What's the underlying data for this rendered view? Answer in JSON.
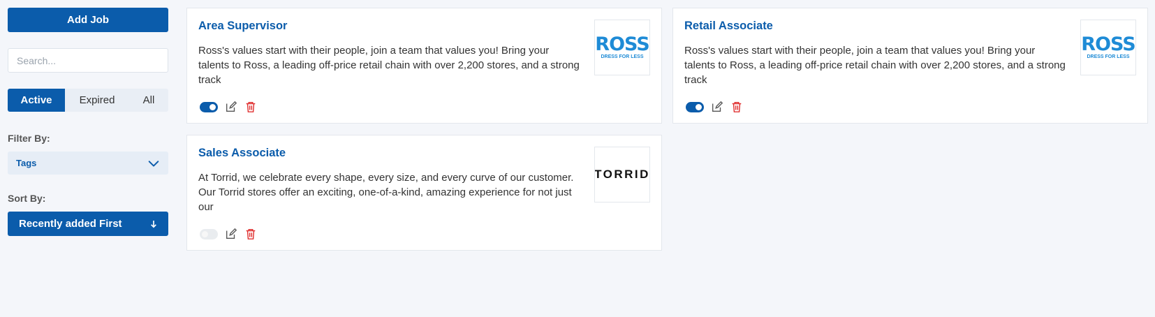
{
  "sidebar": {
    "add_job_label": "Add Job",
    "search_placeholder": "Search...",
    "filters": [
      "Active",
      "Expired",
      "All"
    ],
    "filter_by_label": "Filter By:",
    "tags_label": "Tags",
    "sort_by_label": "Sort By:",
    "sort_value": "Recently added First"
  },
  "jobs": [
    {
      "title": "Area Supervisor",
      "description": "Ross's values start with their people, join a team that values you! Bring your talents to Ross, a leading off-price retail chain with over 2,200 stores, and a strong track",
      "logo_text": "ROSS",
      "logo_sub": "DRESS FOR LESS",
      "active": true
    },
    {
      "title": "Retail Associate",
      "description": "Ross's values start with their people, join a team that values you! Bring your talents to Ross, a leading off-price retail chain with over 2,200 stores, and a strong track",
      "logo_text": "ROSS",
      "logo_sub": "DRESS FOR LESS",
      "active": true
    },
    {
      "title": "Sales Associate",
      "description": "At Torrid, we celebrate every shape, every size, and every curve of our customer. Our Torrid stores offer an exciting, one-of-a-kind, amazing experience for not just our",
      "logo_text": "TORRID",
      "active": false
    }
  ],
  "colors": {
    "primary": "#0b5cab",
    "delete": "#e03131",
    "ross_blue": "#1e8bd6"
  }
}
